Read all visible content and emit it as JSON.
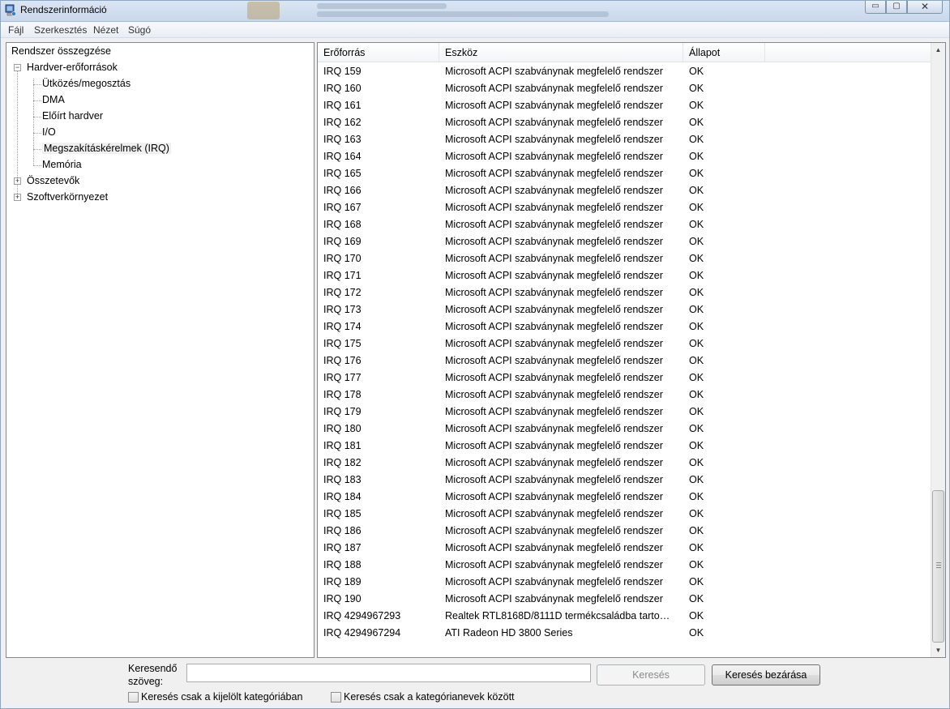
{
  "window": {
    "title": "Rendszerinformáció",
    "minimize_glyph": "▭",
    "maximize_glyph": "▢",
    "close_glyph": "✕"
  },
  "menu": [
    "Fájl",
    "Szerkesztés",
    "Nézet",
    "Súgó"
  ],
  "tree": {
    "root": "Rendszer összegzése",
    "items": [
      {
        "label": "Hardver-erőforrások",
        "expander": "−"
      },
      {
        "label": "Ütközés/megosztás"
      },
      {
        "label": "DMA"
      },
      {
        "label": "Előírt hardver"
      },
      {
        "label": "I/O"
      },
      {
        "label": "Megszakításkérelmek (IRQ)"
      },
      {
        "label": "Memória"
      },
      {
        "label": "Összetevők",
        "expander": "+"
      },
      {
        "label": "Szoftverkörnyezet",
        "expander": "+"
      }
    ]
  },
  "list": {
    "columns": [
      "Erőforrás",
      "Eszköz",
      "Állapot"
    ],
    "rows": [
      [
        "IRQ 159",
        "Microsoft ACPI szabványnak megfelelő rendszer",
        "OK"
      ],
      [
        "IRQ 160",
        "Microsoft ACPI szabványnak megfelelő rendszer",
        "OK"
      ],
      [
        "IRQ 161",
        "Microsoft ACPI szabványnak megfelelő rendszer",
        "OK"
      ],
      [
        "IRQ 162",
        "Microsoft ACPI szabványnak megfelelő rendszer",
        "OK"
      ],
      [
        "IRQ 163",
        "Microsoft ACPI szabványnak megfelelő rendszer",
        "OK"
      ],
      [
        "IRQ 164",
        "Microsoft ACPI szabványnak megfelelő rendszer",
        "OK"
      ],
      [
        "IRQ 165",
        "Microsoft ACPI szabványnak megfelelő rendszer",
        "OK"
      ],
      [
        "IRQ 166",
        "Microsoft ACPI szabványnak megfelelő rendszer",
        "OK"
      ],
      [
        "IRQ 167",
        "Microsoft ACPI szabványnak megfelelő rendszer",
        "OK"
      ],
      [
        "IRQ 168",
        "Microsoft ACPI szabványnak megfelelő rendszer",
        "OK"
      ],
      [
        "IRQ 169",
        "Microsoft ACPI szabványnak megfelelő rendszer",
        "OK"
      ],
      [
        "IRQ 170",
        "Microsoft ACPI szabványnak megfelelő rendszer",
        "OK"
      ],
      [
        "IRQ 171",
        "Microsoft ACPI szabványnak megfelelő rendszer",
        "OK"
      ],
      [
        "IRQ 172",
        "Microsoft ACPI szabványnak megfelelő rendszer",
        "OK"
      ],
      [
        "IRQ 173",
        "Microsoft ACPI szabványnak megfelelő rendszer",
        "OK"
      ],
      [
        "IRQ 174",
        "Microsoft ACPI szabványnak megfelelő rendszer",
        "OK"
      ],
      [
        "IRQ 175",
        "Microsoft ACPI szabványnak megfelelő rendszer",
        "OK"
      ],
      [
        "IRQ 176",
        "Microsoft ACPI szabványnak megfelelő rendszer",
        "OK"
      ],
      [
        "IRQ 177",
        "Microsoft ACPI szabványnak megfelelő rendszer",
        "OK"
      ],
      [
        "IRQ 178",
        "Microsoft ACPI szabványnak megfelelő rendszer",
        "OK"
      ],
      [
        "IRQ 179",
        "Microsoft ACPI szabványnak megfelelő rendszer",
        "OK"
      ],
      [
        "IRQ 180",
        "Microsoft ACPI szabványnak megfelelő rendszer",
        "OK"
      ],
      [
        "IRQ 181",
        "Microsoft ACPI szabványnak megfelelő rendszer",
        "OK"
      ],
      [
        "IRQ 182",
        "Microsoft ACPI szabványnak megfelelő rendszer",
        "OK"
      ],
      [
        "IRQ 183",
        "Microsoft ACPI szabványnak megfelelő rendszer",
        "OK"
      ],
      [
        "IRQ 184",
        "Microsoft ACPI szabványnak megfelelő rendszer",
        "OK"
      ],
      [
        "IRQ 185",
        "Microsoft ACPI szabványnak megfelelő rendszer",
        "OK"
      ],
      [
        "IRQ 186",
        "Microsoft ACPI szabványnak megfelelő rendszer",
        "OK"
      ],
      [
        "IRQ 187",
        "Microsoft ACPI szabványnak megfelelő rendszer",
        "OK"
      ],
      [
        "IRQ 188",
        "Microsoft ACPI szabványnak megfelelő rendszer",
        "OK"
      ],
      [
        "IRQ 189",
        "Microsoft ACPI szabványnak megfelelő rendszer",
        "OK"
      ],
      [
        "IRQ 190",
        "Microsoft ACPI szabványnak megfelelő rendszer",
        "OK"
      ],
      [
        "IRQ 4294967293",
        "Realtek RTL8168D/8111D termékcsaládba tarto…",
        "OK"
      ],
      [
        "IRQ 4294967294",
        "ATI Radeon HD 3800 Series",
        "OK"
      ]
    ]
  },
  "scrollbar": {
    "up_glyph": "▲",
    "down_glyph": "▼"
  },
  "search": {
    "label_line1": "Keresendő",
    "label_line2": "szöveg:",
    "value": "",
    "search_button": "Keresés",
    "close_button": "Keresés bezárása",
    "check_selected_category": "Keresés csak a kijelölt kategóriában",
    "check_category_names": "Keresés csak a kategórianevek között"
  }
}
